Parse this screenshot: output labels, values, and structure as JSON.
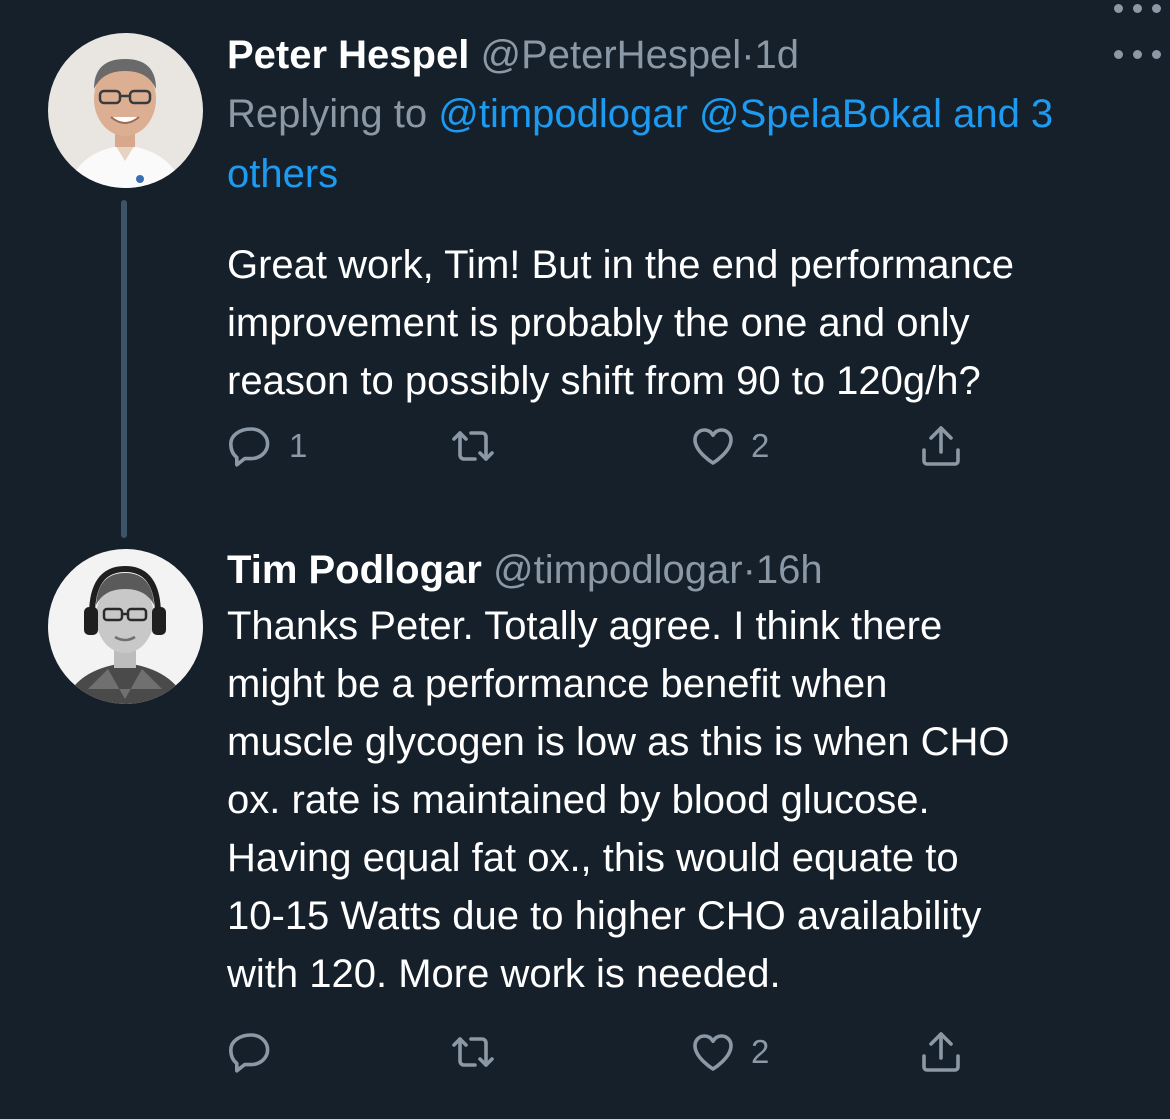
{
  "tweets": [
    {
      "name": "Peter Hespel",
      "handle": "@PeterHespel",
      "separator": "·",
      "time": "1d",
      "replying_prefix": "Replying to",
      "mention1": "@timpodlogar",
      "mention2": "@SpelaBokal",
      "and_others": "and 3 others",
      "lines": [
        "Great work, Tim! But in the end performance",
        "improvement is probably the one and only",
        "reason to possibly shift from 90 to 120g/h?"
      ],
      "reply_count": "1",
      "retweet_count": "",
      "like_count": "2"
    },
    {
      "name": "Tim Podlogar",
      "handle": "@timpodlogar",
      "separator": "·",
      "time": "16h",
      "lines": [
        "Thanks Peter. Totally agree. I think there",
        "might be a performance benefit when",
        "muscle glycogen is low as this is when CHO",
        "ox. rate is maintained by blood glucose.",
        "Having equal fat ox., this would equate to",
        "10-15 Watts due to higher CHO availability",
        "with 120. More work is needed."
      ],
      "reply_count": "",
      "retweet_count": "",
      "like_count": "2"
    }
  ],
  "icons": {
    "reply": "reply-icon",
    "retweet": "retweet-icon",
    "like": "heart-icon",
    "share": "share-icon",
    "more": "more-icon"
  },
  "colors": {
    "background": "#15202b",
    "text": "#ffffff",
    "secondary": "#8b98a5",
    "link": "#1d9bf0",
    "thread_line": "#3d5466"
  }
}
